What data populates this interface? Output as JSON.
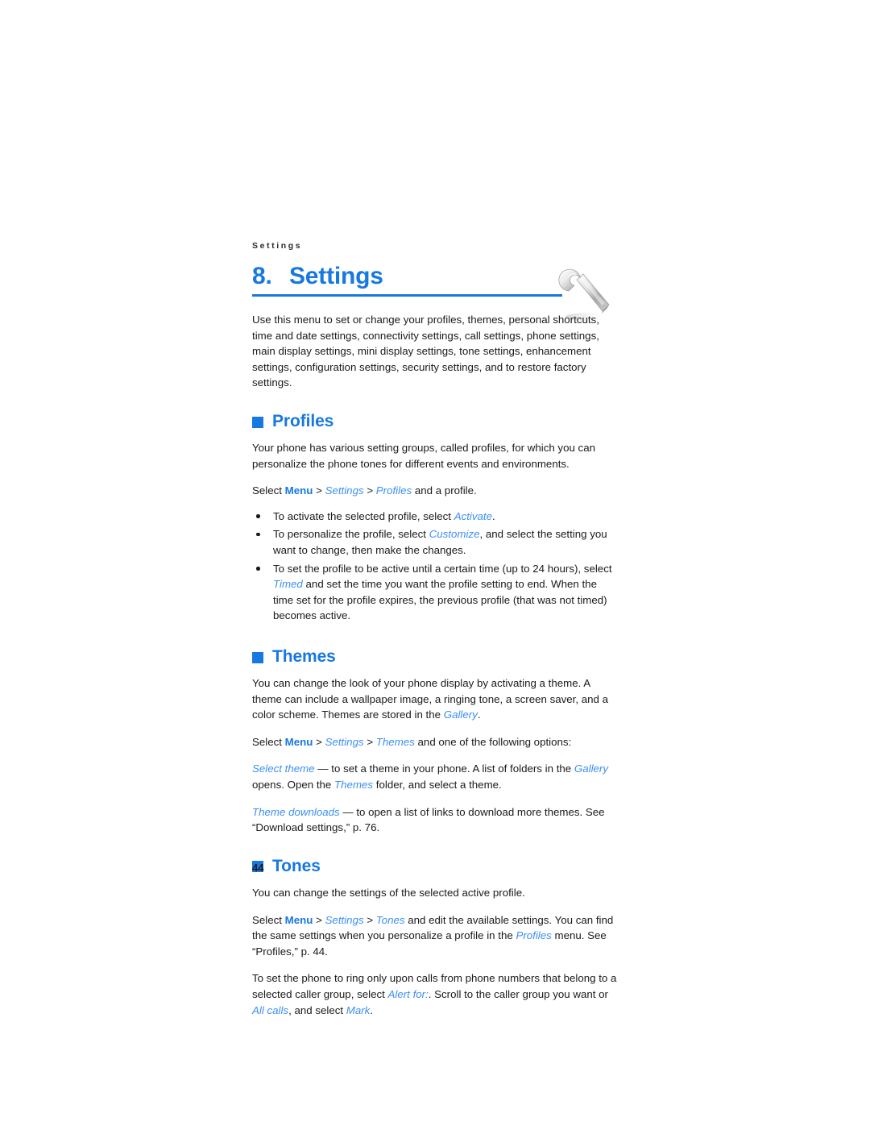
{
  "document": {
    "running_header": "Settings",
    "chapter_number": "8.",
    "chapter_title": "Settings",
    "page_number": "44",
    "decor_icon": "wrench-icon"
  },
  "colors": {
    "accent_blue": "#1778e0",
    "link_italic_blue": "#3d8ff2",
    "body_text": "#1a1a1a",
    "rule": "#1778e0"
  },
  "intro": {
    "paragraph": "Use this menu to set or change your profiles, themes, personal shortcuts, time and date settings, connectivity settings, call settings, phone settings, main display settings, mini display settings, tone settings, enhancement settings, configuration settings, security settings, and to restore factory settings."
  },
  "sections": [
    {
      "id": "profiles",
      "title": "Profiles",
      "intro": "Your phone has various setting groups, called profiles, for which you can personalize the phone tones for different events and environments.",
      "path": {
        "select": "Select",
        "menu": "Menu",
        "sep": ">",
        "settings": "Settings",
        "leaf": "Profiles",
        "tail": "and a profile."
      },
      "bullets": [
        {
          "pre": "To activate the selected profile, select ",
          "em": "Activate",
          "post": "."
        },
        {
          "pre": "To personalize the profile, select ",
          "em": "Customize",
          "post": ", and select the setting you want to change, then make the changes."
        },
        {
          "pre": "To set the profile to be active until a certain time (up to 24 hours), select ",
          "em": "Timed",
          "post": " and set the time you want the profile setting to end. When the time set for the profile expires, the previous profile (that was not timed) becomes active."
        }
      ]
    },
    {
      "id": "themes",
      "title": "Themes",
      "intro_a": "You can change the look of your phone display by activating a theme. A theme can include a wallpaper image, a ringing tone, a screen saver, and a color scheme. Themes are stored in the ",
      "intro_em": "Gallery",
      "intro_b": ".",
      "path": {
        "select": "Select",
        "menu": "Menu",
        "sep": ">",
        "settings": "Settings",
        "leaf": "Themes",
        "tail": "and one of the following options:"
      },
      "options": [
        {
          "em": "Select theme",
          "a": " — to set a theme in your phone. A list of folders in the ",
          "em2": "Gallery",
          "b": " opens. Open the ",
          "em3": "Themes",
          "c": " folder, and select a theme."
        },
        {
          "em": "Theme downloads",
          "a": " — to open a list of links to download more themes. See “Download settings,” p. 76."
        }
      ]
    },
    {
      "id": "tones",
      "title": "Tones",
      "intro": "You can change the settings of the selected active profile.",
      "path": {
        "select": "Select",
        "menu": "Menu",
        "sep": ">",
        "settings": "Settings",
        "leaf": "Tones",
        "tail_a": "and edit the available settings. You can find the same settings when you personalize a profile in the ",
        "tail_em": "Profiles",
        "tail_b": " menu. See “Profiles,” p. 44."
      },
      "last_paragraph": {
        "a": "To set the phone to ring only upon calls from phone numbers that belong to a selected caller group, select ",
        "em1": "Alert for:",
        "b": ". Scroll to the caller group you want or ",
        "em2": "All calls",
        "c": ", and select ",
        "em3": "Mark",
        "d": "."
      }
    }
  ]
}
